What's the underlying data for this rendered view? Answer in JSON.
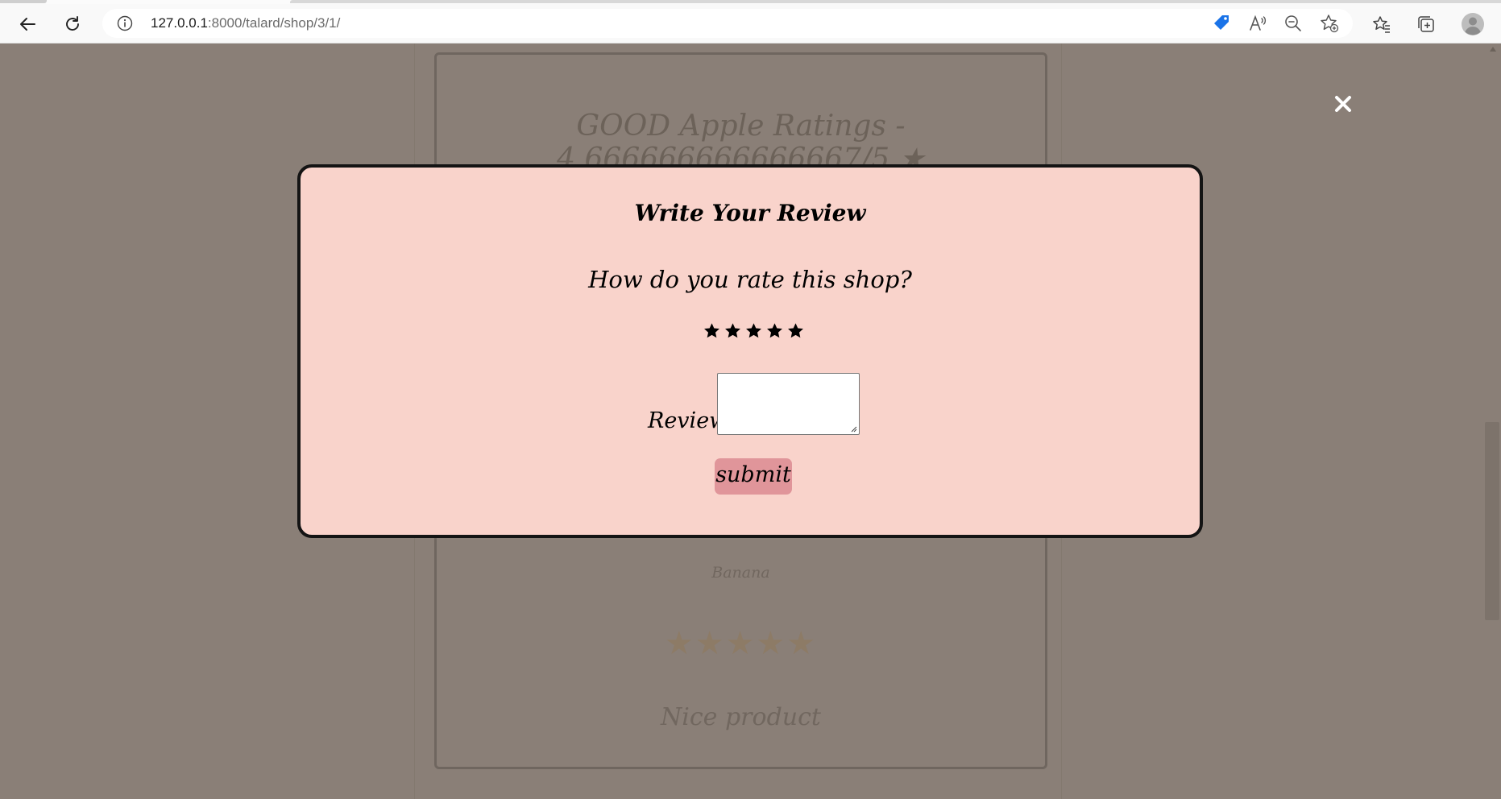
{
  "browser": {
    "url_host": "127.0.0.1",
    "url_path": ":8000/talard/shop/3/1/"
  },
  "background_page": {
    "rating_title": "GOOD Apple Ratings - 4.666666666666667/5",
    "product_name": "Banana",
    "review_stars": 5,
    "review_comment": "Nice product"
  },
  "modal": {
    "title": "Write Your Review",
    "question": "How do you rate this shop?",
    "star_count": 5,
    "review_label": "Review:",
    "review_value": "",
    "submit_label": "submit"
  },
  "colors": {
    "overlay_bg": "#8a7f77",
    "modal_bg": "#f9d3cb",
    "submit_bg": "#e0959a",
    "url_tag_icon": "#1a73e8"
  },
  "icons": [
    "back-arrow-icon",
    "refresh-icon",
    "info-icon",
    "shopping-tag-icon",
    "read-aloud-icon",
    "zoom-out-icon",
    "add-favorite-icon",
    "favorites-icon",
    "collections-icon",
    "profile-icon",
    "close-icon",
    "star-icon"
  ]
}
